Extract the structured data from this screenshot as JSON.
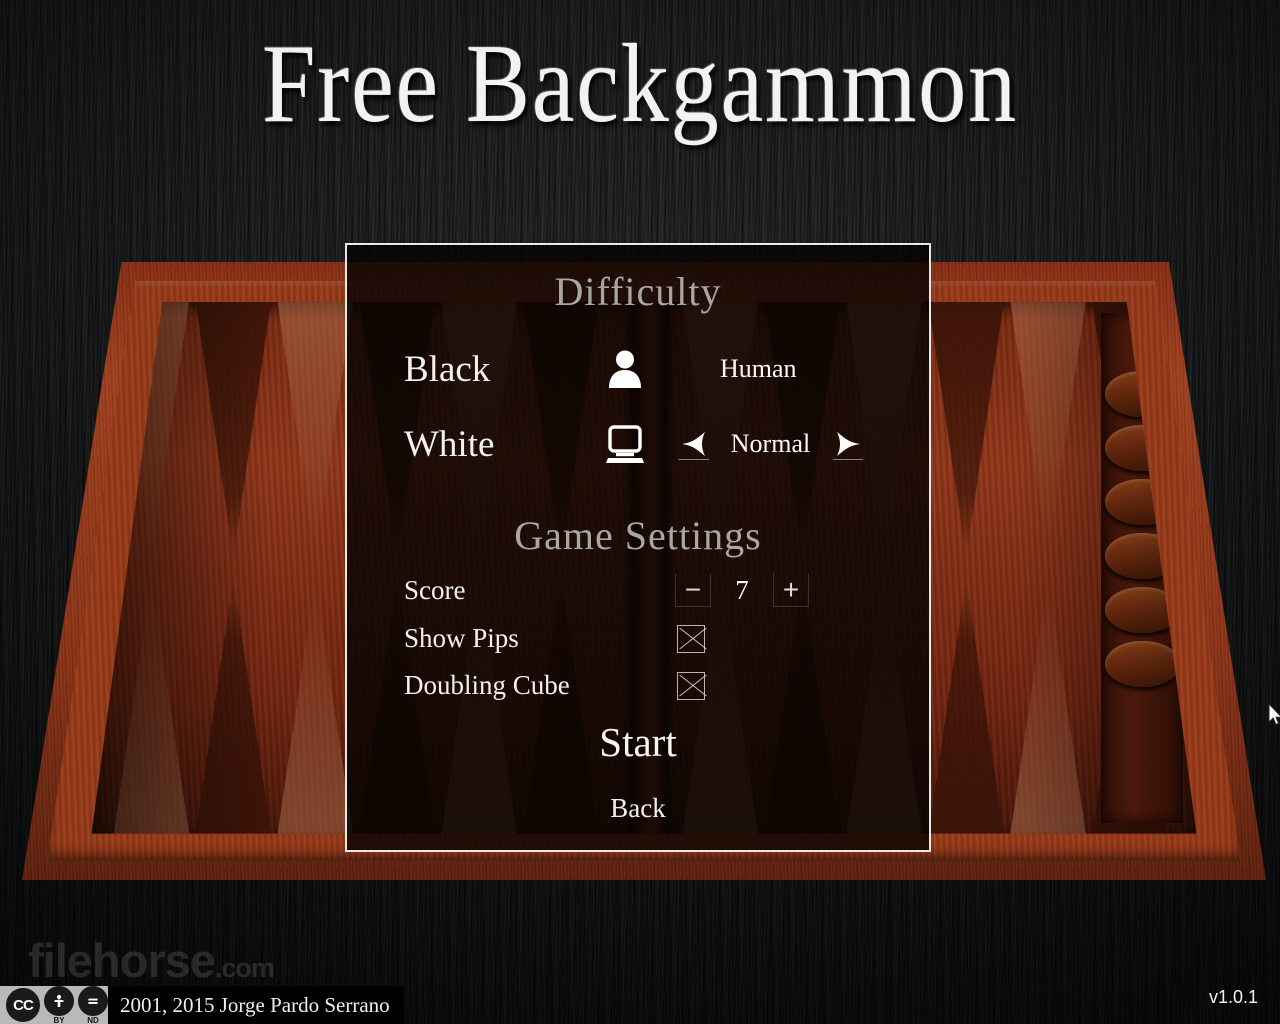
{
  "app": {
    "title": "Free Backgammon",
    "version_label": "v1.0.1"
  },
  "dialog": {
    "difficulty": {
      "header": "Difficulty",
      "rows": [
        {
          "label": "Black",
          "icon": "person-icon",
          "value": "Human",
          "has_arrows": false
        },
        {
          "label": "White",
          "icon": "computer-icon",
          "value": "Normal",
          "has_arrows": true,
          "prev_arrow": "left-arrow-icon",
          "next_arrow": "right-arrow-icon"
        }
      ]
    },
    "game_settings": {
      "header": "Game Settings",
      "score": {
        "label": "Score",
        "value": "7",
        "decrement_label": "−",
        "increment_label": "+"
      },
      "show_pips": {
        "label": "Show Pips",
        "checked": true
      },
      "doubling_cube": {
        "label": "Doubling Cube",
        "checked": true
      }
    },
    "actions": {
      "start_label": "Start",
      "back_label": "Back"
    }
  },
  "footer": {
    "watermark_name": "filehorse",
    "watermark_tld": ".com",
    "license": {
      "badge_main": "CC",
      "badge_by": "BY",
      "badge_nd": "ND"
    },
    "copyright": "2001, 2015  Jorge Pardo Serrano"
  },
  "colors": {
    "dialog_border": "#e8e8e6",
    "header_text": "#a9a7a2",
    "body_text": "#f4f2ef",
    "board_wood": "#97381a",
    "backdrop": "#141617"
  }
}
